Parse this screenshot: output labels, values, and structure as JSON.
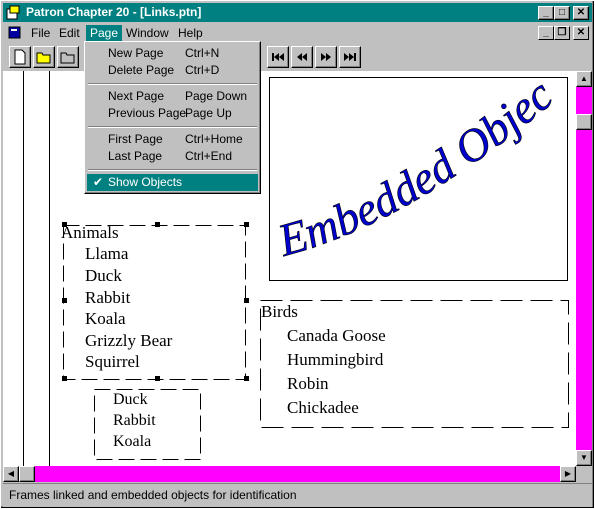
{
  "window": {
    "title": "Patron Chapter 20 - [Links.ptn]"
  },
  "menubar": {
    "items": [
      "File",
      "Edit",
      "Page",
      "Window",
      "Help"
    ]
  },
  "page_menu": {
    "items": [
      {
        "label": "New Page",
        "shortcut": "Ctrl+N"
      },
      {
        "label": "Delete Page",
        "shortcut": "Ctrl+D"
      },
      {
        "label": "Next Page",
        "shortcut": "Page Down"
      },
      {
        "label": "Previous Page",
        "shortcut": "Page Up"
      },
      {
        "label": "First Page",
        "shortcut": "Ctrl+Home"
      },
      {
        "label": "Last Page",
        "shortcut": "Ctrl+End"
      },
      {
        "label": "Show Objects",
        "shortcut": "",
        "checked": true
      }
    ]
  },
  "embedded_object": {
    "text": "Embedded Object!"
  },
  "animals": {
    "title": "Animals",
    "items": [
      "Llama",
      "Duck",
      "Rabbit",
      "Koala",
      "Grizzly Bear",
      "Squirrel"
    ]
  },
  "linked": {
    "items": [
      "Duck",
      "Rabbit",
      "Koala"
    ]
  },
  "birds": {
    "title": "Birds",
    "items": [
      "Canada Goose",
      "Hummingbird",
      "Robin",
      "Chickadee"
    ]
  },
  "status": {
    "text": "Frames linked and embedded objects for identification"
  },
  "colors": {
    "titlebar": "#008080",
    "scrollbar": "#ff00ff",
    "wordart": "#0000cc"
  }
}
